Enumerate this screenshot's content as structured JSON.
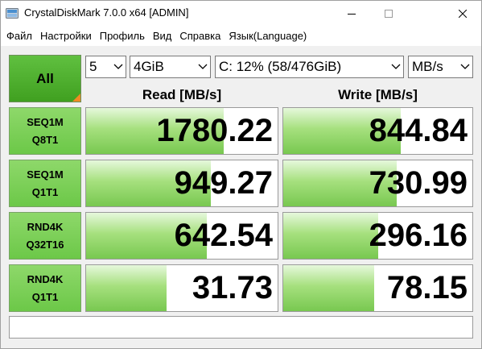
{
  "window": {
    "title": "CrystalDiskMark 7.0.0 x64 [ADMIN]"
  },
  "menu": [
    "Файл",
    "Настройки",
    "Профиль",
    "Вид",
    "Справка",
    "Язык(Language)"
  ],
  "controls": {
    "all_label": "All",
    "count": "5",
    "size": "4GiB",
    "drive": "C: 12% (58/476GiB)",
    "unit": "MB/s"
  },
  "headers": {
    "read": "Read [MB/s]",
    "write": "Write [MB/s]"
  },
  "tests": [
    {
      "line1": "SEQ1M",
      "line2": "Q8T1",
      "read": "1780.22",
      "write": "844.84",
      "read_fill": 0.72,
      "write_fill": 0.62
    },
    {
      "line1": "SEQ1M",
      "line2": "Q1T1",
      "read": "949.27",
      "write": "730.99",
      "read_fill": 0.65,
      "write_fill": 0.6
    },
    {
      "line1": "RND4K",
      "line2": "Q32T16",
      "read": "642.54",
      "write": "296.16",
      "read_fill": 0.63,
      "write_fill": 0.5
    },
    {
      "line1": "RND4K",
      "line2": "Q1T1",
      "read": "31.73",
      "write": "78.15",
      "read_fill": 0.42,
      "write_fill": 0.48
    }
  ],
  "colors": {
    "all_button": "#4caf30",
    "test_button": "#7dd058",
    "bar_green": "#78c850",
    "corner_orange": "#f08a24"
  },
  "icons": {
    "app": "crystaldiskmark-icon",
    "minimize": "minimize-icon",
    "maximize": "maximize-icon",
    "close": "close-icon",
    "dropdown": "chevron-down-icon"
  }
}
